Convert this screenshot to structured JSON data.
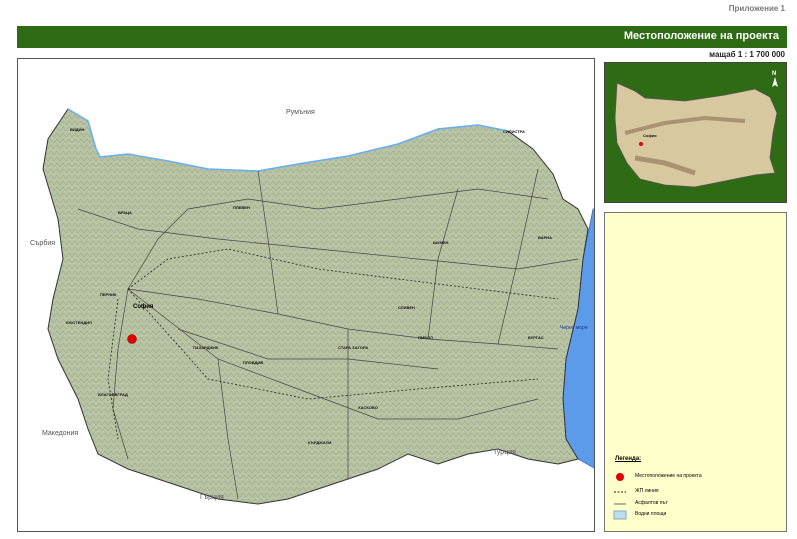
{
  "header": {
    "appendix": "Приложение 1",
    "title": "Местоположение на проекта",
    "scale": "мащаб 1 : 1 700 000"
  },
  "map": {
    "countries": {
      "romania": "Румъния",
      "serbia": "Сърбия",
      "macedonia": "Македония",
      "greece": "Гърция",
      "turkey": "Турция"
    },
    "sea": "Черно море",
    "capital": "София",
    "cities": [
      "ВИДИН",
      "СИЛИСТРА",
      "ВРАЦА",
      "ПЛЕВЕН",
      "ШУМЕН",
      "ВАРНА",
      "ПЛОВДИВ",
      "СТАРА ЗАГОРА",
      "ЯМБОЛ",
      "БУРГАС",
      "БЛАГОЕВГРАД",
      "КЪРДЖАЛИ",
      "ХАСКОВО",
      "ПАЗАРДЖИК",
      "КЮСТЕНДИЛ",
      "ПЕРНИК",
      "СЛИВЕН"
    ],
    "colors": {
      "land": "#b8c4a4",
      "relief": "#9aa88a",
      "sea": "#5b9bea",
      "marker": "#e00000",
      "frame": "#2e6b14"
    }
  },
  "inset": {
    "capital": "София",
    "north": "N"
  },
  "legend": {
    "title": "Легенда:",
    "items": [
      {
        "label": "Местоположение на проекта",
        "symbol": "red-dot"
      },
      {
        "label": "ЖП линия",
        "symbol": "railway-line"
      },
      {
        "label": "Асфалтов път",
        "symbol": "road-line"
      },
      {
        "label": "Водни площи",
        "symbol": "water-area"
      }
    ]
  }
}
